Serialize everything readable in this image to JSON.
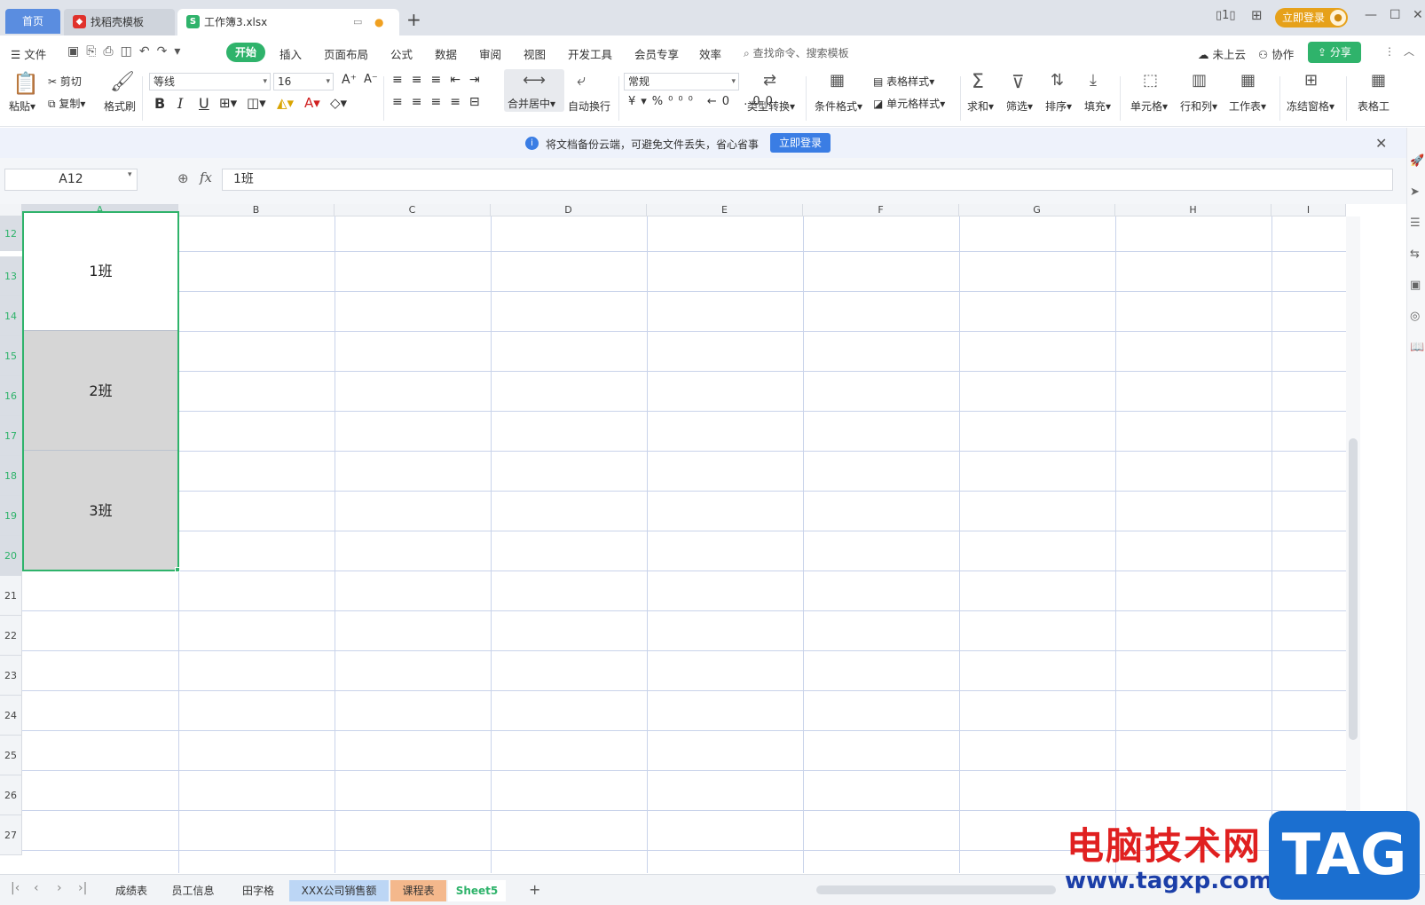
{
  "titlebar": {
    "tab_home": "首页",
    "tab_template": "找稻壳模板",
    "tab_doc": "工作簿3.xlsx",
    "login": "立即登录"
  },
  "menubar": {
    "file": "文件",
    "items": [
      "开始",
      "插入",
      "页面布局",
      "公式",
      "数据",
      "审阅",
      "视图",
      "开发工具",
      "会员专享",
      "效率"
    ],
    "search_placeholder": "查找命令、搜索模板",
    "cloud": "未上云",
    "collab": "协作",
    "share": "分享"
  },
  "ribbon": {
    "paste": "粘贴",
    "cut": "剪切",
    "copy": "复制",
    "format_painter": "格式刷",
    "font_name": "等线",
    "font_size": "16",
    "merge_center": "合并居中",
    "wrap_text": "自动换行",
    "number_format": "常规",
    "type_convert": "类型转换",
    "cond_format": "条件格式",
    "table_style": "表格样式",
    "cell_style": "单元格样式",
    "sum": "求和",
    "filter": "筛选",
    "sort": "排序",
    "fill": "填充",
    "cell": "单元格",
    "row_col": "行和列",
    "worksheet": "工作表",
    "freeze": "冻结窗格",
    "table_tools": "表格工"
  },
  "banner": {
    "text": "将文档备份云端，可避免文件丢失，省心省事",
    "button": "立即登录"
  },
  "formula": {
    "name_box": "A12",
    "fx": "fx",
    "value": "1班"
  },
  "grid": {
    "columns": [
      "A",
      "B",
      "C",
      "D",
      "E",
      "F",
      "G",
      "H",
      "I"
    ],
    "rows": [
      "12",
      "13",
      "14",
      "15",
      "16",
      "17",
      "18",
      "19",
      "20",
      "21",
      "22",
      "23",
      "24",
      "25",
      "26",
      "27"
    ],
    "merged_cells": [
      "1班",
      "2班",
      "3班"
    ]
  },
  "sheets": {
    "tabs": [
      "成绩表",
      "员工信息",
      "田字格",
      "XXX公司销售额",
      "课程表",
      "Sheet5"
    ],
    "active": "Sheet5"
  },
  "watermark": {
    "text": "电脑技术网",
    "url": "www.tagxp.com",
    "logo": "TAG"
  }
}
